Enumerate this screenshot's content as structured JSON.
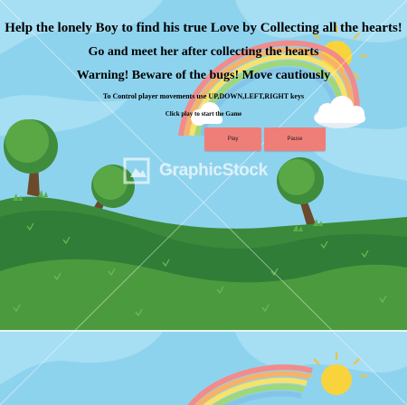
{
  "game": {
    "instructions": {
      "line1": "Help the lonely Boy to find his true Love by Collecting all the hearts!",
      "line2": "Go and meet her after collecting the hearts",
      "line3": "Warning! Beware of the bugs! Move cautiously",
      "controls": "To Control player movements use UP,DOWN,LEFT,RIGHT keys",
      "start_hint": "Click play to start the Game"
    },
    "buttons": {
      "play_label": "Play",
      "pause_label": "Pause",
      "color": "#f07e78"
    },
    "watermark": {
      "text": "GraphicStock"
    },
    "colors": {
      "sky": "#8ed3ee",
      "hill_dark": "#2f7d37",
      "hill_light": "#4c9a3e",
      "sun": "#f9d33b"
    }
  }
}
